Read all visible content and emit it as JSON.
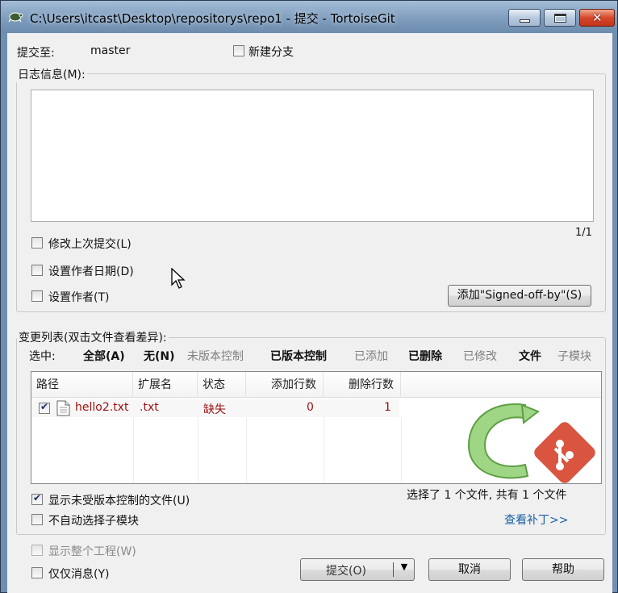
{
  "window": {
    "title": "C:\\Users\\itcast\\Desktop\\repositorys\\repo1 - 提交 - TortoiseGit",
    "minimize_icon": "minimize-icon",
    "maximize_icon": "maximize-icon",
    "close_icon": "close-icon",
    "close_glyph": "✕"
  },
  "commit": {
    "commit_to_label": "提交至:",
    "branch": "master",
    "new_branch_label": "新建分支",
    "new_branch_checked": false
  },
  "message": {
    "group_label": "日志信息(M):",
    "value": "",
    "counter": "1/1",
    "amend_label": "修改上次提交(L)",
    "amend_checked": false,
    "set_date_label": "设置作者日期(D)",
    "set_date_checked": false,
    "set_author_label": "设置作者(T)",
    "set_author_checked": false,
    "signoff_button": "添加\"Signed-off-by\"(S)"
  },
  "changes": {
    "group_label": "变更列表(双击文件查看差异):",
    "select_label": "选中:",
    "filters": [
      {
        "label": "全部(A)",
        "style": "bold"
      },
      {
        "label": "无(N)",
        "style": "bold"
      },
      {
        "label": "未版本控制",
        "style": "dim"
      },
      {
        "label": "已版本控制",
        "style": "bold"
      },
      {
        "label": "已添加",
        "style": "dim"
      },
      {
        "label": "已删除",
        "style": "bold"
      },
      {
        "label": "已修改",
        "style": "dim"
      },
      {
        "label": "文件",
        "style": "bold"
      },
      {
        "label": "子模块",
        "style": "dim"
      }
    ],
    "columns": [
      "路径",
      "扩展名",
      "状态",
      "添加行数",
      "删除行数"
    ],
    "rows": [
      {
        "checked": true,
        "path": "hello2.txt",
        "ext": ".txt",
        "status": "缺失",
        "added": "0",
        "deleted": "1"
      }
    ],
    "show_unversioned_label": "显示未受版本控制的文件(U)",
    "show_unversioned_checked": true,
    "no_autoselect_label": "不自动选择子模块",
    "no_autoselect_checked": false,
    "summary": "选择了 1 个文件, 共有 1 个文件",
    "view_patch_link": "查看补丁>>"
  },
  "bottom": {
    "show_whole_project_label": "显示整个工程(W)",
    "show_whole_project_checked": false,
    "message_only_label": "仅仅消息(Y)",
    "message_only_checked": false,
    "commit_button": "提交(O)",
    "cancel_button": "取消",
    "help_button": "帮助"
  },
  "colors": {
    "title_bar": "#7f9dbd",
    "close_button": "#d6472a",
    "file_missing_text": "#9b1010",
    "link": "#1b5fa8",
    "tortoisegit_green": "#7fbf5f",
    "git_red": "#d9553f"
  }
}
